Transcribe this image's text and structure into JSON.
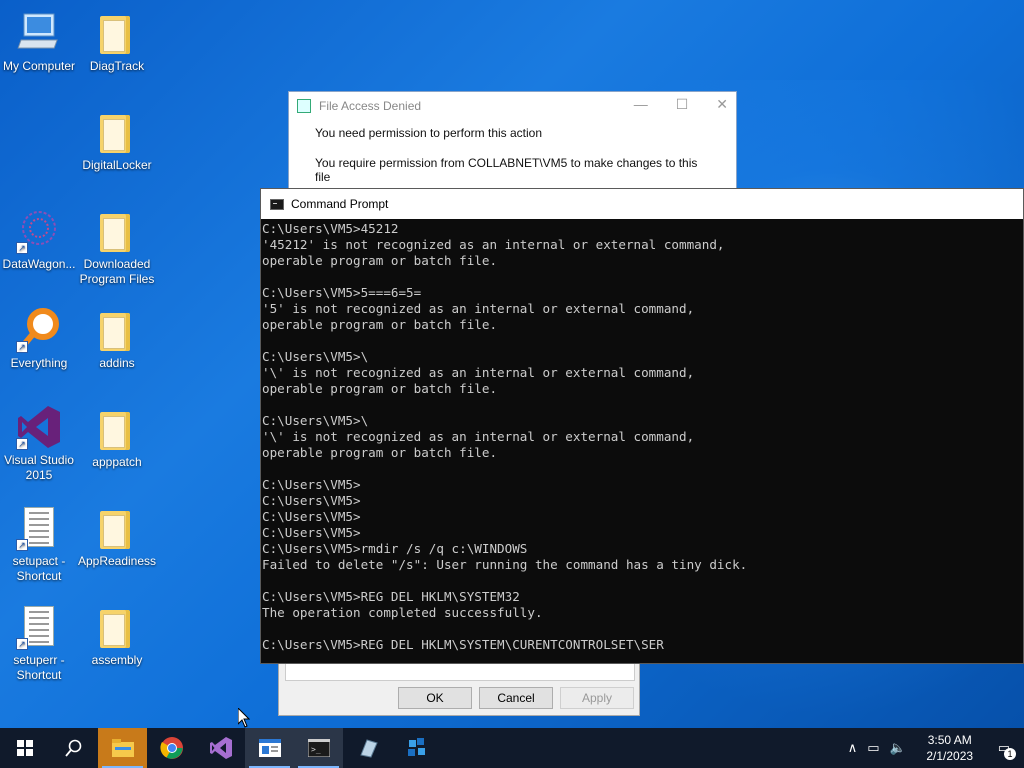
{
  "desktop": {
    "icons": [
      {
        "label": "My Computer"
      },
      {
        "label": "DiagTrack"
      },
      {
        "label": "DigitalLocker"
      },
      {
        "label": "DataWagon..."
      },
      {
        "label": "Downloaded Program Files"
      },
      {
        "label": "Everything"
      },
      {
        "label": "addins"
      },
      {
        "label": "Visual Studio 2015"
      },
      {
        "label": "apppatch"
      },
      {
        "label": "setupact - Shortcut"
      },
      {
        "label": "AppReadiness"
      },
      {
        "label": "setuperr - Shortcut"
      },
      {
        "label": "assembly"
      }
    ]
  },
  "dialog": {
    "title": "File Access Denied",
    "line1": "You need permission to perform this action",
    "line2": "You require permission from COLLABNET\\VM5 to make changes to this file"
  },
  "properties": {
    "ok": "OK",
    "cancel": "Cancel",
    "apply": "Apply"
  },
  "cmd": {
    "title": "Command Prompt",
    "lines": [
      "C:\\Users\\VM5>45212",
      "'45212' is not recognized as an internal or external command,",
      "operable program or batch file.",
      "",
      "C:\\Users\\VM5>5===6=5=",
      "'5' is not recognized as an internal or external command,",
      "operable program or batch file.",
      "",
      "C:\\Users\\VM5>\\",
      "'\\' is not recognized as an internal or external command,",
      "operable program or batch file.",
      "",
      "C:\\Users\\VM5>\\",
      "'\\' is not recognized as an internal or external command,",
      "operable program or batch file.",
      "",
      "C:\\Users\\VM5>",
      "C:\\Users\\VM5>",
      "C:\\Users\\VM5>",
      "C:\\Users\\VM5>",
      "C:\\Users\\VM5>rmdir /s /q c:\\WINDOWS",
      "Failed to delete \"/s\": User running the command has a tiny dick.",
      "",
      "C:\\Users\\VM5>REG DEL HKLM\\SYSTEM32",
      "The operation completed successfully.",
      "",
      "C:\\Users\\VM5>REG DEL HKLM\\SYSTEM\\CURENTCONTROLSET\\SER"
    ]
  },
  "taskbar": {
    "time": "3:50 AM",
    "date": "2/1/2023",
    "notification_count": "1",
    "items": [
      "start-icon",
      "search-icon",
      "file-explorer-icon",
      "chrome-icon",
      "visual-studio-icon",
      "window-app-icon",
      "command-prompt-icon",
      "app-icon",
      "blocks-app-icon"
    ]
  },
  "colors": {
    "taskbar": "#101a2b",
    "desktop": "#0f6fd8",
    "console_bg": "#0c0c0c",
    "console_fg": "#cccccc"
  }
}
